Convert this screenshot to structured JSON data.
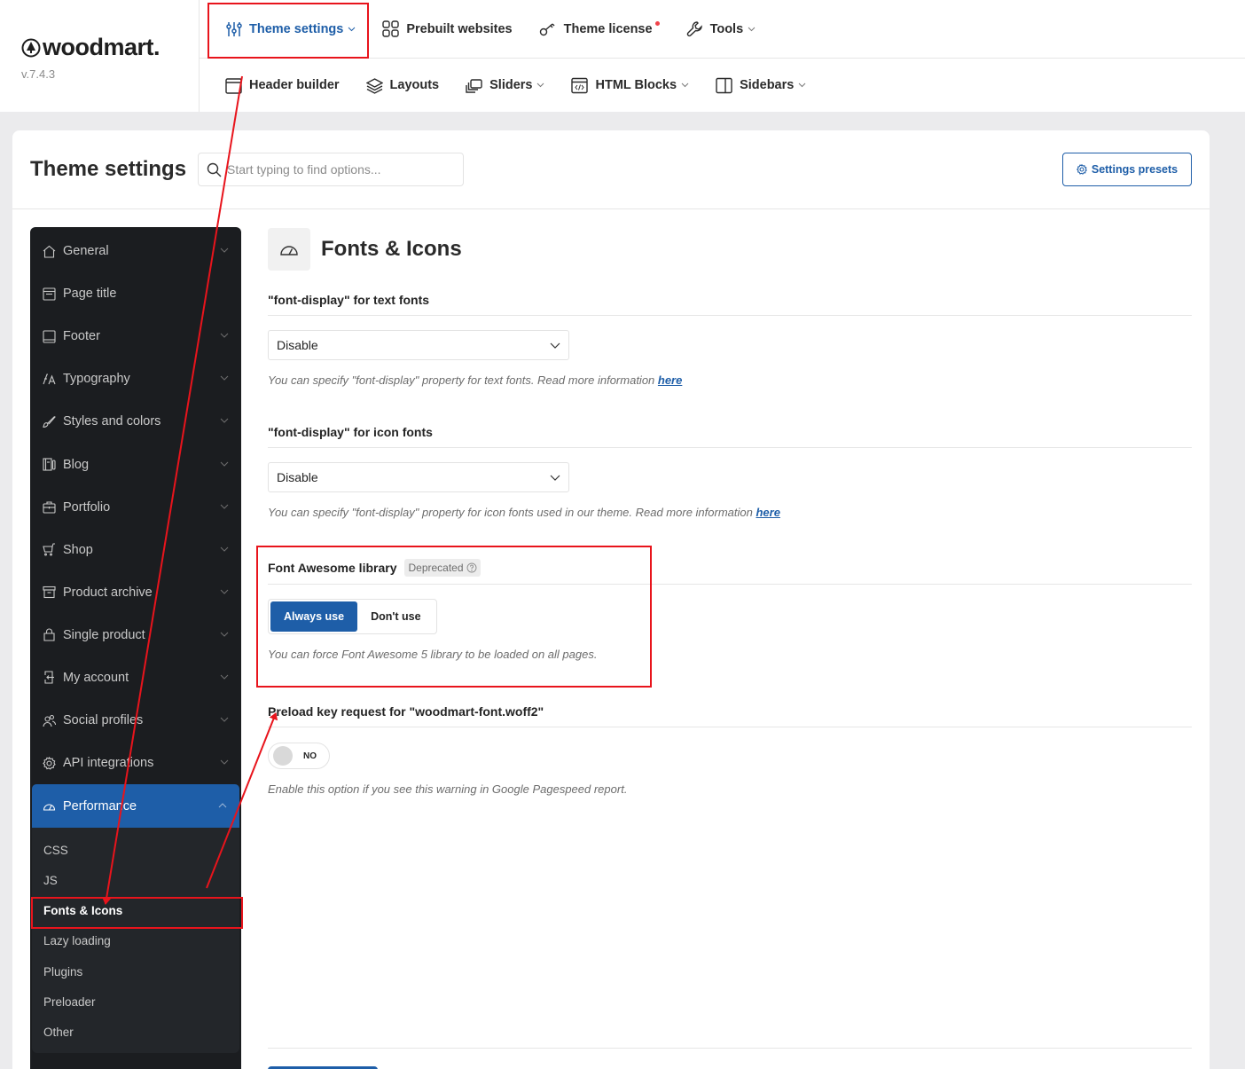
{
  "brand": {
    "name": "woodmart.",
    "version": "v.7.4.3"
  },
  "top_nav": {
    "row1": [
      {
        "label": "Theme settings",
        "icon": "sliders-icon",
        "caret": true,
        "active": true
      },
      {
        "label": "Prebuilt websites",
        "icon": "grid-icon",
        "caret": false
      },
      {
        "label": "Theme license",
        "icon": "key-icon",
        "caret": false,
        "notification_dot": true
      },
      {
        "label": "Tools",
        "icon": "wrench-icon",
        "caret": true
      }
    ],
    "row2": [
      {
        "label": "Header builder",
        "icon": "window-icon",
        "caret": false
      },
      {
        "label": "Layouts",
        "icon": "layers-icon",
        "caret": false
      },
      {
        "label": "Sliders",
        "icon": "slides-icon",
        "caret": true
      },
      {
        "label": "HTML Blocks",
        "icon": "code-block-icon",
        "caret": true
      },
      {
        "label": "Sidebars",
        "icon": "sidebar-icon",
        "caret": true
      }
    ]
  },
  "header": {
    "title": "Theme settings",
    "search_placeholder": "Start typing to find options...",
    "search_value": "",
    "presets_button": "Settings presets"
  },
  "sidebar": {
    "items": [
      {
        "label": "General",
        "icon": "home-icon",
        "chevron": true
      },
      {
        "label": "Page title",
        "icon": "page-title-icon",
        "chevron": false
      },
      {
        "label": "Footer",
        "icon": "footer-icon",
        "chevron": true
      },
      {
        "label": "Typography",
        "icon": "typography-icon",
        "chevron": true
      },
      {
        "label": "Styles and colors",
        "icon": "brush-icon",
        "chevron": true
      },
      {
        "label": "Blog",
        "icon": "blog-icon",
        "chevron": true
      },
      {
        "label": "Portfolio",
        "icon": "briefcase-icon",
        "chevron": true
      },
      {
        "label": "Shop",
        "icon": "cart-icon",
        "chevron": true
      },
      {
        "label": "Product archive",
        "icon": "archive-icon",
        "chevron": true
      },
      {
        "label": "Single product",
        "icon": "bag-icon",
        "chevron": true
      },
      {
        "label": "My account",
        "icon": "login-icon",
        "chevron": true
      },
      {
        "label": "Social profiles",
        "icon": "users-icon",
        "chevron": true
      },
      {
        "label": "API integrations",
        "icon": "gear-icon",
        "chevron": true
      },
      {
        "label": "Performance",
        "icon": "gauge-icon",
        "chevron": true,
        "expanded": true
      }
    ],
    "performance_sub": [
      {
        "label": "CSS"
      },
      {
        "label": "JS"
      },
      {
        "label": "Fonts & Icons",
        "current": true
      },
      {
        "label": "Lazy loading"
      },
      {
        "label": "Plugins"
      },
      {
        "label": "Preloader"
      },
      {
        "label": "Other"
      }
    ]
  },
  "content": {
    "section_title": "Fonts & Icons",
    "options": {
      "text_fonts": {
        "title": "\"font-display\" for text fonts",
        "value": "Disable",
        "desc": "You can specify \"font-display\" property for text fonts. Read more information ",
        "link": "here"
      },
      "icon_fonts": {
        "title": "\"font-display\" for icon fonts",
        "value": "Disable",
        "desc": "You can specify \"font-display\" property for icon fonts used in our theme. Read more information ",
        "link": "here"
      },
      "font_awesome": {
        "title": "Font Awesome library",
        "badge": "Deprecated",
        "choices": [
          "Always use",
          "Don't use"
        ],
        "selected": "Always use",
        "desc": "You can force Font Awesome 5 library to be loaded on all pages."
      },
      "preload": {
        "title": "Preload key request for \"woodmart-font.woff2\"",
        "toggle_label": "NO",
        "toggle_on": false,
        "desc": "Enable this option if you see this warning in Google Pagespeed report."
      }
    }
  },
  "colors": {
    "accent": "#1e5ea8",
    "sidebar_bg": "#1b1d20",
    "annotation": "#e8141c"
  }
}
